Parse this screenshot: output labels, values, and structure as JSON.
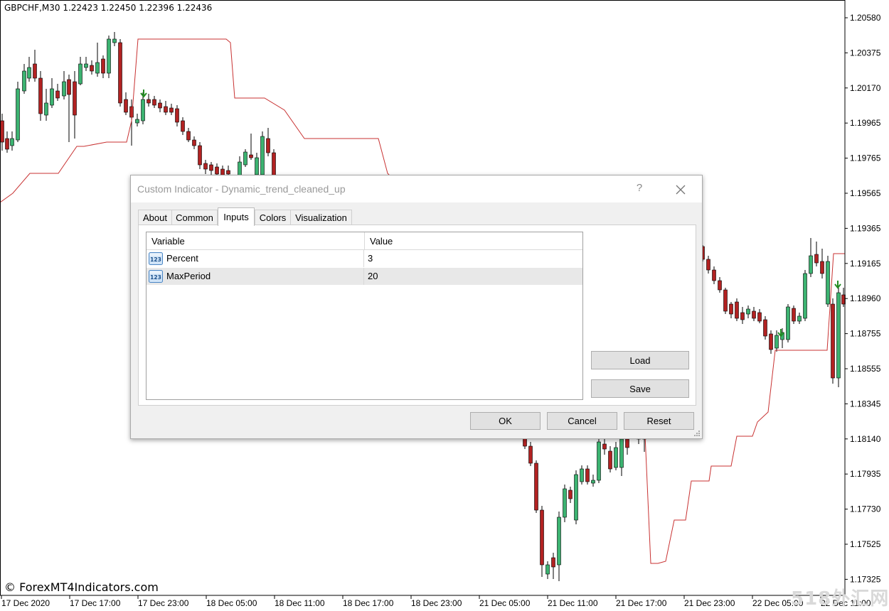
{
  "chart": {
    "symbol_header": "GBPCHF,M30  1.22423 1.22450 1.22396 1.22436",
    "price_labels": [
      "1.20580",
      "1.20375",
      "1.20170",
      "1.19965",
      "1.19765",
      "1.19565",
      "1.19365",
      "1.19165",
      "1.18960",
      "1.18755",
      "1.18555",
      "1.18345",
      "1.18140",
      "1.17935",
      "1.17730",
      "1.17525",
      "1.17325"
    ],
    "time_labels": [
      "17 Dec 2020",
      "17 Dec 17:00",
      "17 Dec 23:00",
      "18 Dec 05:00",
      "18 Dec 11:00",
      "18 Dec 17:00",
      "18 Dec 23:00",
      "21 Dec 05:00",
      "21 Dec 11:00",
      "21 Dec 17:00",
      "21 Dec 23:00",
      "22 Dec 05:00",
      "22 Dec 11:00"
    ],
    "watermark": "© ForexMT4Indicators.com",
    "site_mark": "518外汇网",
    "colors": {
      "bull": "#3cb371",
      "bear": "#b22222",
      "trend_line": "#c83232",
      "arrow": "#228b22"
    }
  },
  "dialog": {
    "title": "Custom Indicator - Dynamic_trend_cleaned_up",
    "help": "?",
    "tabs": [
      "About",
      "Common",
      "Inputs",
      "Colors",
      "Visualization"
    ],
    "active_tab": "Inputs",
    "table": {
      "headers": [
        "Variable",
        "Value"
      ],
      "rows": [
        {
          "variable": "Percent",
          "value": "3",
          "icon": "number-123-icon"
        },
        {
          "variable": "MaxPeriod",
          "value": "20",
          "icon": "number-123-icon"
        }
      ]
    },
    "buttons": {
      "load": "Load",
      "save": "Save",
      "ok": "OK",
      "cancel": "Cancel",
      "reset": "Reset"
    }
  }
}
